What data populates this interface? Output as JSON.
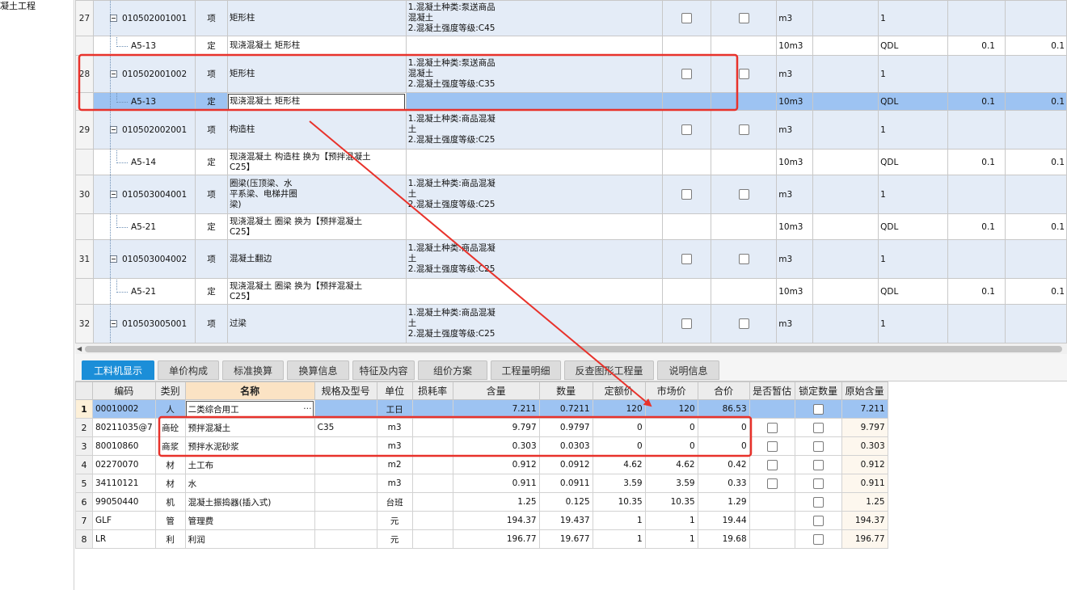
{
  "left_tree": {
    "label": "凝土工程"
  },
  "top_rows": [
    {
      "kind": "item",
      "num": "27",
      "code": "010502001001",
      "type": "项",
      "name": "矩形柱",
      "feature": "1.混凝土种类:泵送商品\n混凝土\n2.混凝土强度等级:C45",
      "unit": "m3",
      "expr": "1",
      "hl": "",
      "qty": ""
    },
    {
      "kind": "quota",
      "num": "",
      "code": "A5-13",
      "type": "定",
      "name": "现浇混凝土 矩形柱",
      "feature": "",
      "unit": "10m3",
      "expr": "QDL",
      "hl": "0.1",
      "qty": "0.1"
    },
    {
      "kind": "item",
      "num": "28",
      "code": "010502001002",
      "type": "项",
      "name": "矩形柱",
      "feature": "1.混凝土种类:泵送商品\n混凝土\n2.混凝土强度等级:C35",
      "unit": "m3",
      "expr": "1",
      "hl": "",
      "qty": ""
    },
    {
      "kind": "selected",
      "num": "",
      "code": "A5-13",
      "type": "定",
      "name": "现浇混凝土 矩形柱",
      "feature": "",
      "unit": "10m3",
      "expr": "QDL",
      "hl": "0.1",
      "qty": "0.1"
    },
    {
      "kind": "item",
      "num": "29",
      "code": "010502002001",
      "type": "项",
      "name": "构造柱",
      "feature": "1.混凝土种类:商品混凝\n土\n2.混凝土强度等级:C25",
      "unit": "m3",
      "expr": "1",
      "hl": "",
      "qty": ""
    },
    {
      "kind": "quota",
      "num": "",
      "code": "A5-14",
      "type": "定",
      "name": "现浇混凝土 构造柱  换为【预拌混凝土\nC25】",
      "feature": "",
      "unit": "10m3",
      "expr": "QDL",
      "hl": "0.1",
      "qty": "0.1"
    },
    {
      "kind": "item",
      "num": "30",
      "code": "010503004001",
      "type": "项",
      "name": "圈梁(压顶梁、水\n平系梁、电梯井圈\n梁)",
      "feature": "1.混凝土种类:商品混凝\n土\n2.混凝土强度等级:C25",
      "unit": "m3",
      "expr": "1",
      "hl": "",
      "qty": ""
    },
    {
      "kind": "quota",
      "num": "",
      "code": "A5-21",
      "type": "定",
      "name": "现浇混凝土 圈梁  换为【预拌混凝土\nC25】",
      "feature": "",
      "unit": "10m3",
      "expr": "QDL",
      "hl": "0.1",
      "qty": "0.1"
    },
    {
      "kind": "item",
      "num": "31",
      "code": "010503004002",
      "type": "项",
      "name": "混凝土翻边",
      "feature": "1.混凝土种类:商品混凝\n土\n2.混凝土强度等级:C25",
      "unit": "m3",
      "expr": "1",
      "hl": "",
      "qty": ""
    },
    {
      "kind": "quota",
      "num": "",
      "code": "A5-21",
      "type": "定",
      "name": "现浇混凝土 圈梁  换为【预拌混凝土\nC25】",
      "feature": "",
      "unit": "10m3",
      "expr": "QDL",
      "hl": "0.1",
      "qty": "0.1"
    },
    {
      "kind": "item",
      "num": "32",
      "code": "010503005001",
      "type": "项",
      "name": "过梁",
      "feature": "1.混凝土种类:商品混凝\n土\n2.混凝土强度等级:C25",
      "unit": "m3",
      "expr": "1",
      "hl": "",
      "qty": ""
    }
  ],
  "tabs": [
    {
      "label": "工料机显示",
      "active": true
    },
    {
      "label": "单价构成",
      "active": false
    },
    {
      "label": "标准换算",
      "active": false
    },
    {
      "label": "换算信息",
      "active": false
    },
    {
      "label": "特征及内容",
      "active": false
    },
    {
      "label": "组价方案",
      "active": false
    },
    {
      "label": "工程量明细",
      "active": false
    },
    {
      "label": "反查图形工程量",
      "active": false
    },
    {
      "label": "说明信息",
      "active": false
    }
  ],
  "bottom_headers": [
    "",
    "编码",
    "类别",
    "名称",
    "规格及型号",
    "单位",
    "损耗率",
    "含量",
    "数量",
    "定额价",
    "市场价",
    "合价",
    "是否暂估",
    "锁定数量",
    "原始含量"
  ],
  "bottom_rows": [
    {
      "n": "1",
      "code": "00010002",
      "cat": "人",
      "name": "二类综合用工",
      "spec": "",
      "unit": "工日",
      "loss": "",
      "content": "7.211",
      "qty": "0.7211",
      "quota_price": "120",
      "market_price": "120",
      "total": "86.53",
      "est": false,
      "lock": true,
      "orig": "7.211",
      "selected": true
    },
    {
      "n": "2",
      "code": "80211035@7",
      "cat": "商砼",
      "name": "预拌混凝土",
      "spec": "C35",
      "unit": "m3",
      "loss": "",
      "content": "9.797",
      "qty": "0.9797",
      "quota_price": "0",
      "market_price": "0",
      "total": "0",
      "est": true,
      "lock": true,
      "orig": "9.797",
      "selected": false
    },
    {
      "n": "3",
      "code": "80010860",
      "cat": "商浆",
      "name": "预拌水泥砂浆",
      "spec": "",
      "unit": "m3",
      "loss": "",
      "content": "0.303",
      "qty": "0.0303",
      "quota_price": "0",
      "market_price": "0",
      "total": "0",
      "est": true,
      "lock": true,
      "orig": "0.303",
      "selected": false
    },
    {
      "n": "4",
      "code": "02270070",
      "cat": "材",
      "name": "土工布",
      "spec": "",
      "unit": "m2",
      "loss": "",
      "content": "0.912",
      "qty": "0.0912",
      "quota_price": "4.62",
      "market_price": "4.62",
      "total": "0.42",
      "est": true,
      "lock": true,
      "orig": "0.912",
      "selected": false
    },
    {
      "n": "5",
      "code": "34110121",
      "cat": "材",
      "name": "水",
      "spec": "",
      "unit": "m3",
      "loss": "",
      "content": "0.911",
      "qty": "0.0911",
      "quota_price": "3.59",
      "market_price": "3.59",
      "total": "0.33",
      "est": true,
      "lock": true,
      "orig": "0.911",
      "selected": false
    },
    {
      "n": "6",
      "code": "99050440",
      "cat": "机",
      "name": "混凝土振捣器(插入式)",
      "spec": "",
      "unit": "台班",
      "loss": "",
      "content": "1.25",
      "qty": "0.125",
      "quota_price": "10.35",
      "market_price": "10.35",
      "total": "1.29",
      "est": false,
      "lock": true,
      "orig": "1.25",
      "selected": false
    },
    {
      "n": "7",
      "code": "GLF",
      "cat": "管",
      "name": "管理费",
      "spec": "",
      "unit": "元",
      "loss": "",
      "content": "194.37",
      "qty": "19.437",
      "quota_price": "1",
      "market_price": "1",
      "total": "19.44",
      "est": false,
      "lock": true,
      "orig": "194.37",
      "selected": false
    },
    {
      "n": "8",
      "code": "LR",
      "cat": "利",
      "name": "利润",
      "spec": "",
      "unit": "元",
      "loss": "",
      "content": "196.77",
      "qty": "19.677",
      "quota_price": "1",
      "market_price": "1",
      "total": "19.68",
      "est": false,
      "lock": true,
      "orig": "196.77",
      "selected": false
    }
  ],
  "annotation": {
    "color": "#e8322b"
  }
}
